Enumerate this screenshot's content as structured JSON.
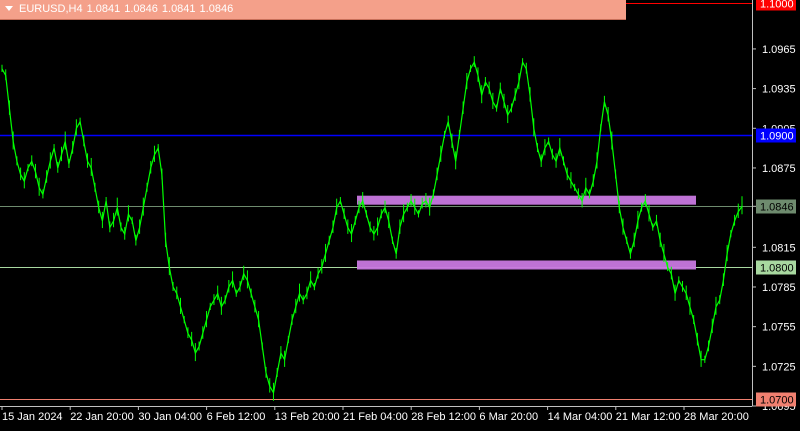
{
  "header": {
    "symbol": "EURUSD,H4",
    "open": "1.0841",
    "high": "1.0846",
    "low": "1.0841",
    "close": "1.0846"
  },
  "chart_data": {
    "type": "line",
    "ylim": [
      1.0695,
      1.1002
    ],
    "y_ticks": [
      "1.0965",
      "1.0935",
      "1.0905",
      "1.0875",
      "1.0846",
      "1.0815",
      "1.0785",
      "1.0755",
      "1.0725",
      "1.0695"
    ],
    "x_ticks": [
      "15 Jan 2024",
      "22 Jan 20:00",
      "30 Jan 04:00",
      "6 Feb 12:00",
      "13 Feb 20:00",
      "21 Feb 04:00",
      "28 Feb 12:00",
      "6 Mar 20:00",
      "14 Mar 04:00",
      "21 Mar 12:00",
      "28 Mar 20:00"
    ],
    "horizontal_lines": [
      {
        "price": 1.1,
        "label": "1.1000",
        "color": "#FF0000"
      },
      {
        "price": 1.09,
        "label": "1.0900",
        "color": "#0000FF"
      },
      {
        "price": 1.0846,
        "label": "1.0846",
        "color": "#6E8B6E"
      },
      {
        "price": 1.08,
        "label": "1.0800",
        "color": "#A8D8A0"
      },
      {
        "price": 1.07,
        "label": "1.0700",
        "color": "#F08070"
      }
    ],
    "zones": [
      {
        "from_x": "21 Feb 04:00",
        "to_x": "24 Mar",
        "price": 1.0851,
        "color": "#C878E0"
      },
      {
        "from_x": "21 Feb 04:00",
        "to_x": "24 Mar",
        "price": 1.0802,
        "color": "#C878E0"
      }
    ],
    "series": [
      {
        "color": "#00FF00",
        "values": [
          1.095,
          1.0945,
          1.092,
          1.0895,
          1.088,
          1.087,
          1.0865,
          1.0875,
          1.088,
          1.0872,
          1.086,
          1.0855,
          1.0868,
          1.088,
          1.089,
          1.0875,
          1.0885,
          1.0895,
          1.0878,
          1.089,
          1.0905,
          1.091,
          1.0895,
          1.088,
          1.0875,
          1.086,
          1.0845,
          1.0835,
          1.085,
          1.083,
          1.0835,
          1.0845,
          1.083,
          1.0825,
          1.084,
          1.0835,
          1.082,
          1.083,
          1.0845,
          1.086,
          1.0875,
          1.0885,
          1.089,
          1.087,
          1.082,
          1.08,
          1.0785,
          1.078,
          1.077,
          1.076,
          1.075,
          1.0745,
          1.0735,
          1.074,
          1.075,
          1.076,
          1.077,
          1.0775,
          1.078,
          1.077,
          1.0775,
          1.0785,
          1.079,
          1.078,
          1.0785,
          1.0795,
          1.079,
          1.078,
          1.077,
          1.076,
          1.074,
          1.072,
          1.071,
          1.0705,
          1.072,
          1.0735,
          1.073,
          1.0745,
          1.076,
          1.077,
          1.078,
          1.0775,
          1.078,
          1.079,
          1.0785,
          1.0795,
          1.08,
          1.081,
          1.082,
          1.083,
          1.0845,
          1.085,
          1.084,
          1.083,
          1.0825,
          1.0835,
          1.0845,
          1.085,
          1.084,
          1.083,
          1.0825,
          1.083,
          1.084,
          1.0845,
          1.0835,
          1.082,
          1.081,
          1.083,
          1.084,
          1.0845,
          1.085,
          1.0845,
          1.084,
          1.0848,
          1.085,
          1.0845,
          1.0855,
          1.087,
          1.0885,
          1.09,
          1.091,
          1.0895,
          1.088,
          1.09,
          1.092,
          1.094,
          1.095,
          1.0955,
          1.0945,
          1.093,
          1.094,
          1.0935,
          1.0925,
          1.092,
          1.0935,
          1.0925,
          1.0915,
          1.092,
          1.093,
          1.094,
          1.0955,
          1.095,
          1.093,
          1.0905,
          1.089,
          1.088,
          1.089,
          1.0895,
          1.0885,
          1.088,
          1.089,
          1.088,
          1.087,
          1.0865,
          1.086,
          1.0855,
          1.085,
          1.086,
          1.0855,
          1.0865,
          1.088,
          1.0905,
          1.0925,
          1.0915,
          1.0895,
          1.087,
          1.0845,
          1.083,
          1.082,
          1.081,
          1.082,
          1.0835,
          1.0845,
          1.085,
          1.084,
          1.083,
          1.0835,
          1.082,
          1.081,
          1.08,
          1.0795,
          1.078,
          1.079,
          1.0785,
          1.078,
          1.077,
          1.076,
          1.0745,
          1.073,
          1.073,
          1.074,
          1.0755,
          1.077,
          1.0775,
          1.079,
          1.081,
          1.0825,
          1.0835,
          1.0842,
          1.0846
        ]
      }
    ]
  }
}
